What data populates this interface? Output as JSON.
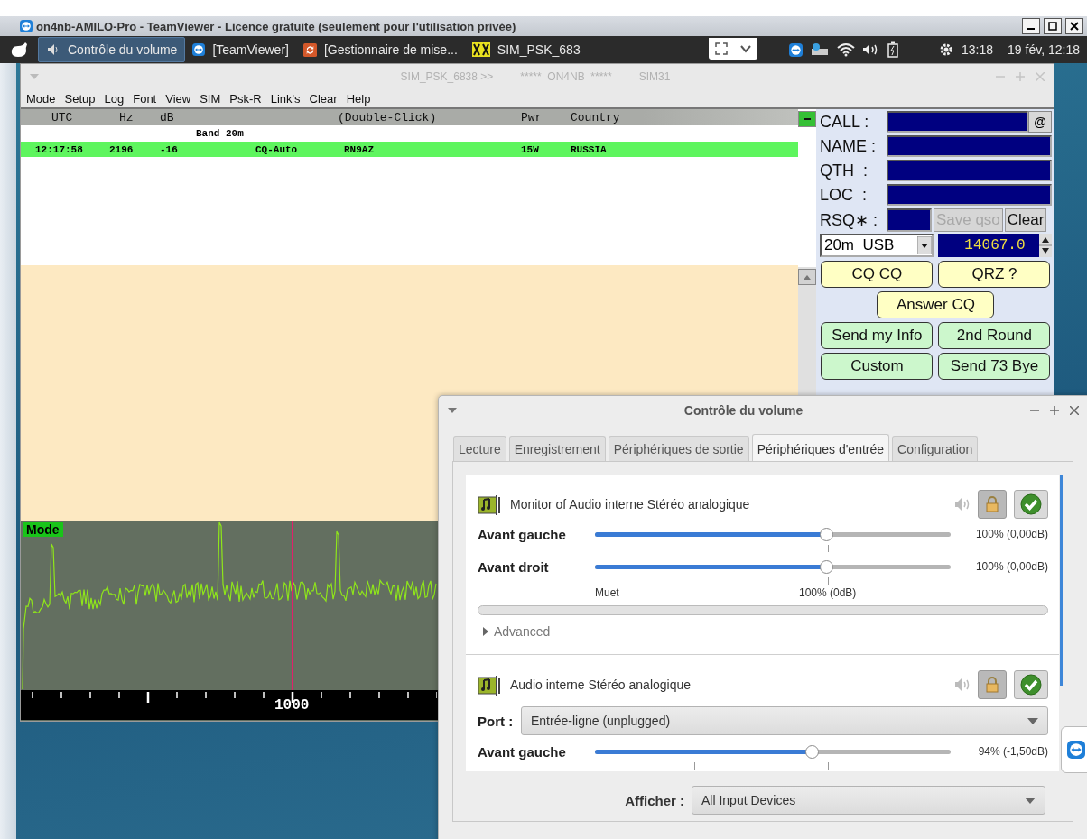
{
  "remote_title": "on4nb-AMILO-Pro - TeamViewer - Licence gratuite (seulement pour l'utilisation privée)",
  "taskbar": {
    "items": [
      {
        "label": "Contrôle du volume",
        "selected": true,
        "kind": "volume"
      },
      {
        "label": "[TeamViewer]",
        "selected": false,
        "kind": "teamviewer"
      },
      {
        "label": "[Gestionnaire de mise...",
        "selected": false,
        "kind": "updates"
      },
      {
        "label": "SIM_PSK_683",
        "selected": false,
        "kind": "psk"
      }
    ],
    "clock": "13:18",
    "date": "19 fév, 12:18"
  },
  "psk_window": {
    "title": [
      "SIM_PSK_6838 >>",
      "*****  ON4NB  *****",
      "SIM31"
    ],
    "menu": [
      "Mode",
      "Setup",
      "Log",
      "Font",
      "View",
      "SIM",
      "Psk-R",
      "Link's",
      "Clear",
      "Help"
    ],
    "table": {
      "columns": [
        "UTC",
        "Hz",
        "dB",
        "(Double-Click)",
        "Pwr",
        "Country"
      ],
      "rows": [
        {
          "kind": "band",
          "label": "Band 20m"
        },
        {
          "kind": "station",
          "selected": true,
          "cells": [
            "12:17:58",
            "2196",
            "-16",
            "CQ-Auto",
            "RN9AZ",
            "15W",
            "RUSSIA"
          ]
        }
      ]
    },
    "spectrum": {
      "mode_label": "Mode",
      "axis_label": "1000"
    },
    "form": {
      "fields": [
        "CALL :",
        "NAME :",
        "QTH  :",
        "LOC  :",
        "RSQ∗ :"
      ],
      "at_button": "@",
      "save_button": {
        "label": "Save qso",
        "disabled": true
      },
      "clear_button": "Clear",
      "band": "20m  USB",
      "frequency": "14067.0",
      "button_rows": [
        {
          "buttons": [
            {
              "label": "CQ CQ",
              "color": "#ffffc4"
            },
            {
              "label": "QRZ ?",
              "color": "#ffffc4"
            }
          ]
        },
        {
          "buttons": [
            {
              "label": "Answer  CQ",
              "color": "#ffffc4"
            }
          ]
        },
        {
          "buttons": [
            {
              "label": "Send my Info",
              "color": "#ccf7cc"
            },
            {
              "label": "2nd  Round",
              "color": "#ccf7cc"
            }
          ]
        },
        {
          "buttons": [
            {
              "label": "Custom",
              "color": "#ccf7cc"
            },
            {
              "label": "Send 73 Bye",
              "color": "#ccf7cc"
            }
          ]
        }
      ]
    }
  },
  "volume_window": {
    "title": "Contrôle du volume",
    "tabs": [
      {
        "label": "Lecture",
        "selected": false
      },
      {
        "label": "Enregistrement",
        "selected": false
      },
      {
        "label": "Périphériques de sortie",
        "selected": false
      },
      {
        "label": "Périphériques d'entrée",
        "selected": true
      },
      {
        "label": "Configuration",
        "selected": false
      }
    ],
    "devices": [
      {
        "name": "Monitor of Audio interne Stéréo analogique",
        "channels": [
          {
            "label": "Avant gauche",
            "level": 0.65,
            "reading": "100% (0,00dB)"
          },
          {
            "label": "Avant droit",
            "level": 0.65,
            "reading": "100% (0,00dB)"
          }
        ],
        "scale_labels": [
          "Muet",
          "100% (0dB)"
        ],
        "peak_meter": {
          "level": 0
        },
        "advanced": {
          "label": "Advanced",
          "expanded": false
        }
      },
      {
        "name": "Audio interne Stéréo analogique",
        "port": {
          "label": "Port :",
          "value": "Entrée-ligne (unplugged)"
        },
        "channels": [
          {
            "label": "Avant gauche",
            "level": 0.61,
            "reading": "94% (-1,50dB)"
          }
        ],
        "base_volume_mark": true
      }
    ],
    "filter": {
      "label": "Afficher :",
      "value": "All Input Devices"
    }
  }
}
